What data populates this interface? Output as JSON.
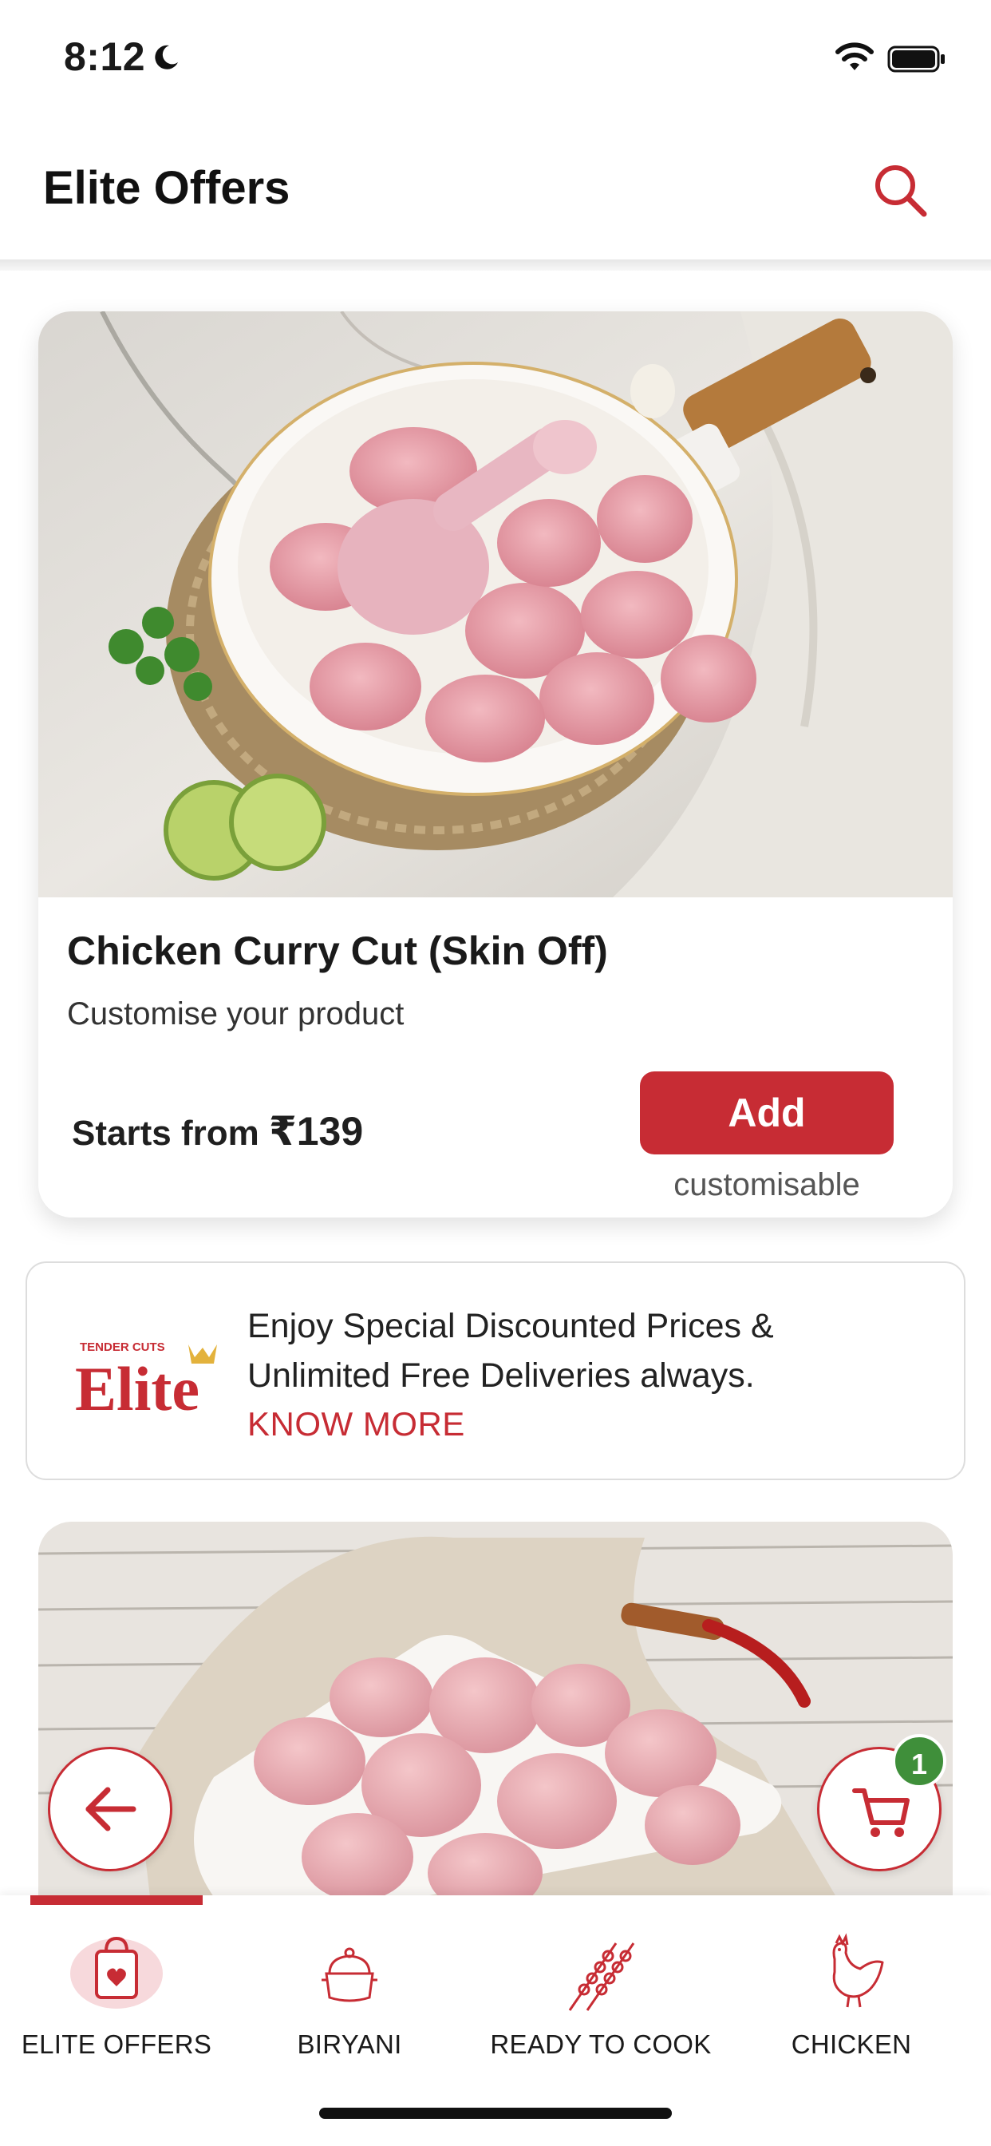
{
  "status_bar": {
    "time": "8:12"
  },
  "header": {
    "title": "Elite Offers"
  },
  "product_card": {
    "title": "Chicken Curry Cut (Skin Off)",
    "subtitle": "Customise your product",
    "price_prefix": "Starts from ",
    "price": "₹139",
    "add_label": "Add",
    "customisable_note": "customisable"
  },
  "elite_banner": {
    "logo_top_text": "TENDER CUTS",
    "logo_text": "Elite",
    "line1": "Enjoy Special Discounted Prices &",
    "line2": "Unlimited Free Deliveries always.",
    "link_label": "KNOW MORE"
  },
  "cart": {
    "count": "1"
  },
  "bottom_nav": {
    "items": [
      {
        "label": "ELITE OFFERS",
        "icon": "elite-bag-icon",
        "active": true
      },
      {
        "label": "BIRYANI",
        "icon": "biryani-pot-icon",
        "active": false
      },
      {
        "label": "READY TO COOK",
        "icon": "skewers-icon",
        "active": false
      },
      {
        "label": "CHICKEN",
        "icon": "chicken-icon",
        "active": false
      }
    ]
  },
  "colors": {
    "accent": "#c72c34",
    "badge": "#3f8f3a"
  }
}
